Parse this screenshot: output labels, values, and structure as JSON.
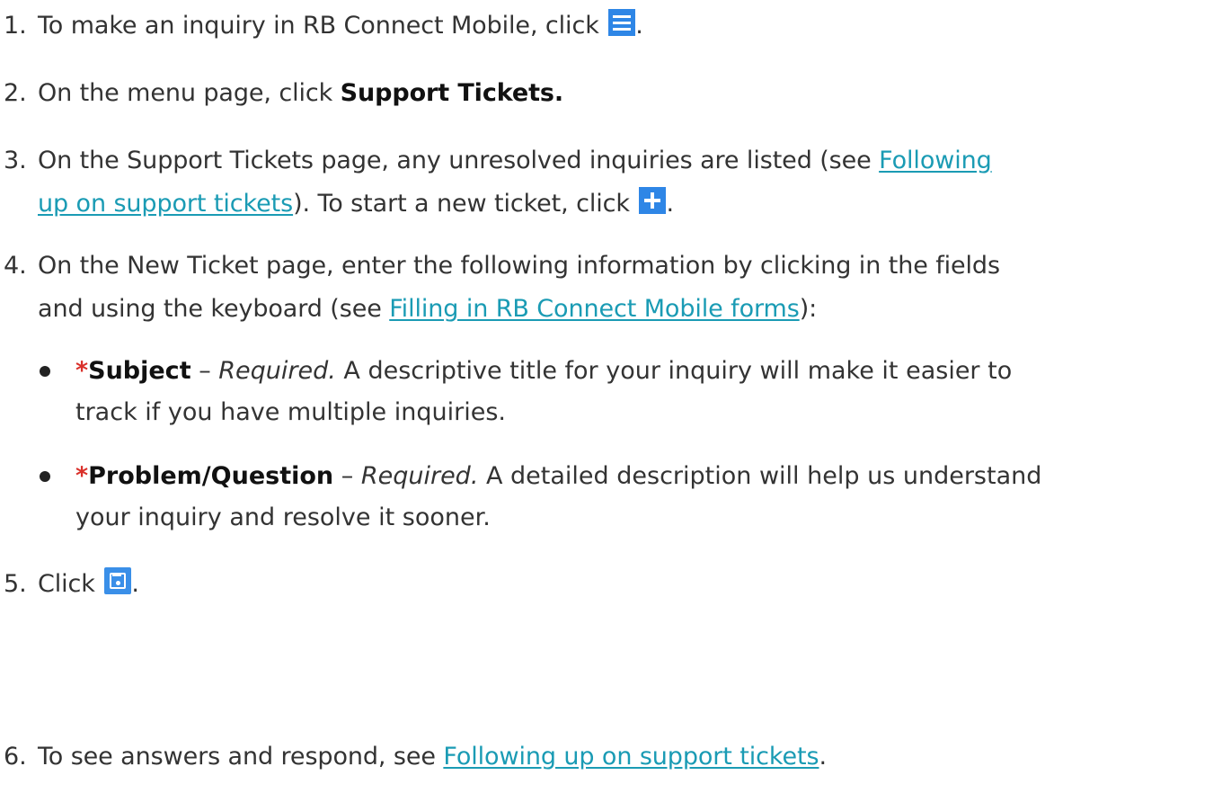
{
  "steps": {
    "s1": {
      "num": "1.",
      "text": "To make an inquiry in RB Connect Mobile, click ",
      "after_icon": ".",
      "icon": "menu-icon"
    },
    "s2": {
      "num": "2.",
      "text": "On the menu page, click ",
      "bold": "Support Tickets."
    },
    "s3": {
      "num": "3.",
      "text": "On the Support Tickets page, any unresolved inquiries are listed (see ",
      "link_a": "Following",
      "link_b": "up on support tickets",
      "text_after_link": "). To start a new ticket, click ",
      "after_icon": ".",
      "icon": "plus-icon"
    },
    "s4": {
      "num": "4.",
      "line1": "On the New Ticket page, enter the following information by clicking in the fields",
      "line2_pre": "and using the keyboard (see ",
      "link": "Filling in RB Connect Mobile forms",
      "line2_post": "):"
    },
    "s5": {
      "num": "5.",
      "text": "Click ",
      "after_icon": ".",
      "icon": "save-icon"
    },
    "s6": {
      "num": "6.",
      "text": "To see answers and respond, see ",
      "link": "Following up on support tickets",
      "after_link": "."
    }
  },
  "bullets": {
    "subject": {
      "asterisk": "*",
      "label": "Subject",
      "dash": " – ",
      "required": "Required.",
      "line1": " A descriptive title for your inquiry will make it easier to",
      "line2": "track if you have multiple inquiries."
    },
    "problem": {
      "asterisk": "*",
      "label": "Problem/Question",
      "dash": " – ",
      "required": "Required.",
      "line1": " A detailed description will help us understand",
      "line2": "your inquiry and resolve it sooner."
    }
  },
  "colors": {
    "text": "#333333",
    "link": "#1a9bb4",
    "required_asterisk": "#d9302a",
    "icon_blue": "#2e86e6"
  }
}
